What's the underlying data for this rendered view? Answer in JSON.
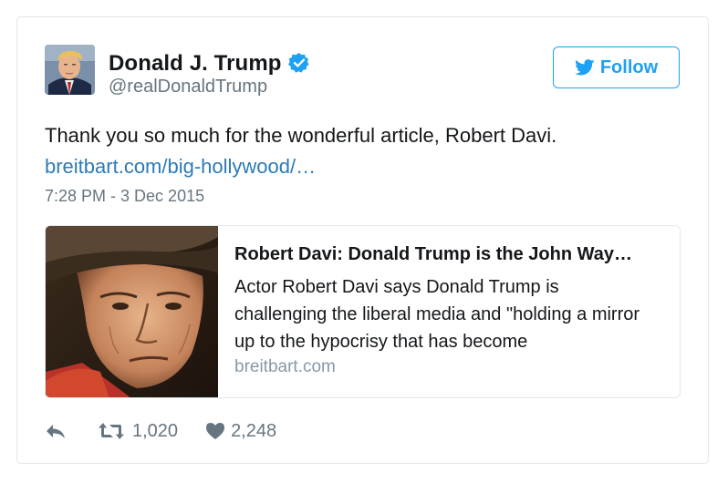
{
  "author": {
    "display_name": "Donald J. Trump",
    "handle": "@realDonaldTrump",
    "verified": true,
    "avatar_icon": "profile-photo"
  },
  "follow_button": {
    "label": "Follow",
    "icon": "twitter-bird-icon",
    "color": "#1da1f2"
  },
  "tweet": {
    "text": "Thank you so much for the wonderful article, Robert Davi.",
    "link": "breitbart.com/big-hollywood/…",
    "timestamp": "7:28 PM - 3 Dec 2015"
  },
  "link_card": {
    "title": "Robert Davi: Donald Trump is the John Way…",
    "description": "Actor Robert Davi says Donald Trump is challenging the liberal media and \"holding a mirror up to the hypocrisy that has become",
    "domain": "breitbart.com",
    "image": "john-wayne-portrait"
  },
  "actions": {
    "reply_icon": "reply-icon",
    "retweet_icon": "retweet-icon",
    "retweet_count": "1,020",
    "like_icon": "heart-icon",
    "like_count": "2,248"
  },
  "colors": {
    "link": "#2b7bb9",
    "secondary_text": "#66757f",
    "border": "#e1e8ed"
  }
}
